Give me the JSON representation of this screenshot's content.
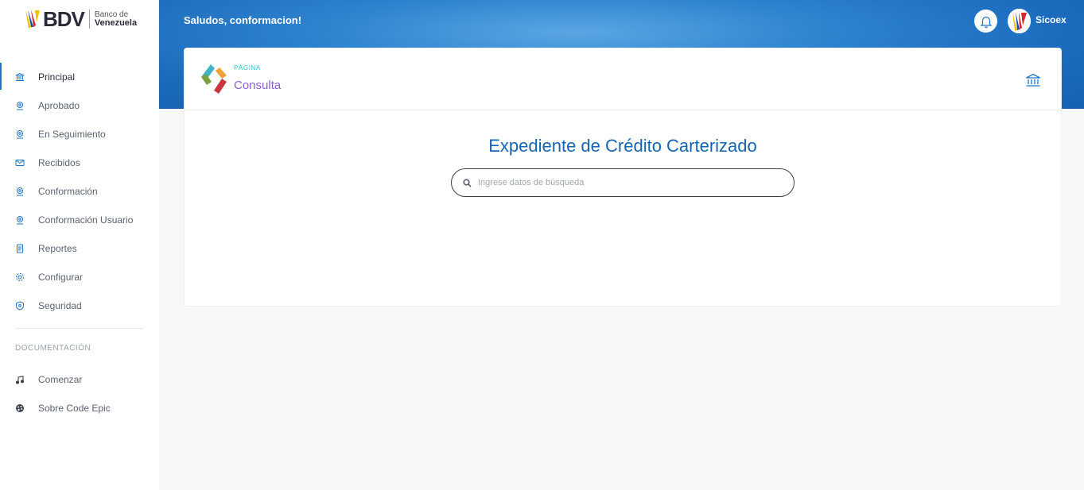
{
  "brand": {
    "name": "BDV",
    "line1": "Banco de",
    "line2": "Venezuela"
  },
  "header": {
    "greeting": "Saludos, conformacion!",
    "username": "Sicoex"
  },
  "sidebar": {
    "items": [
      {
        "label": "Principal",
        "icon": "bank-icon",
        "active": true
      },
      {
        "label": "Aprobado",
        "icon": "location-pin-icon"
      },
      {
        "label": "En Seguimiento",
        "icon": "location-pin-icon"
      },
      {
        "label": "Recibidos",
        "icon": "envelope-icon"
      },
      {
        "label": "Conformación",
        "icon": "location-pin-icon"
      },
      {
        "label": "Conformación Usuario",
        "icon": "location-pin-icon"
      },
      {
        "label": "Reportes",
        "icon": "document-icon"
      },
      {
        "label": "Configurar",
        "icon": "gear-icon"
      },
      {
        "label": "Seguridad",
        "icon": "shield-icon"
      }
    ],
    "section_title": "DOCUMENTACIÓN",
    "doc_items": [
      {
        "label": "Comenzar",
        "icon": "music-note-icon"
      },
      {
        "label": "Sobre Code Epic",
        "icon": "palette-icon"
      }
    ]
  },
  "page": {
    "kicker": "PÁGINA",
    "title": "Consulta",
    "main_title": "Expediente de Crédito Carterizado"
  },
  "search": {
    "placeholder": "Ingrese datos de búsqueda",
    "value": ""
  },
  "colors": {
    "accent": "#1e74c6",
    "banner": "#2f83cf",
    "title": "#1565b3",
    "page_title": "#8a5fc9"
  }
}
